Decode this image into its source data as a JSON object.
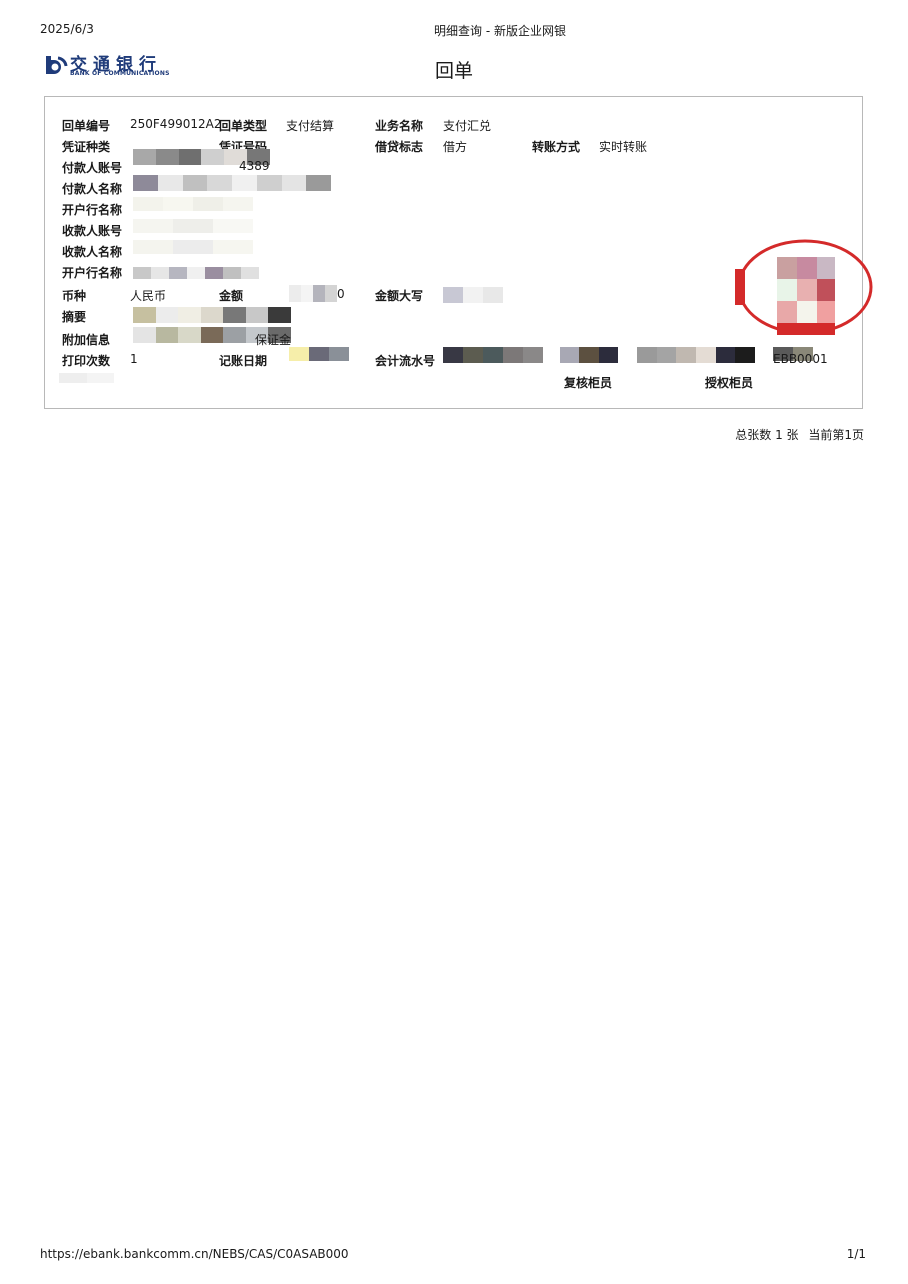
{
  "header": {
    "date": "2025/6/3",
    "page_title": "明细查询 - 新版企业网银"
  },
  "logo": {
    "cn_text": "交通银行",
    "en_text": "BANK OF COMMUNICATIONS",
    "mark_icon": "bocom-logo-icon"
  },
  "doc_title": "回单",
  "receipt": {
    "receipt_no_label": "回单编号",
    "receipt_no": "250F499012A2",
    "receipt_type_label": "回单类型",
    "receipt_type": "支付结算",
    "business_name_label": "业务名称",
    "business_name": "支付汇兑",
    "voucher_type_label": "凭证种类",
    "voucher_no_label": "凭证号码",
    "debit_credit_label": "借贷标志",
    "debit_credit": "借方",
    "transfer_mode_label": "转账方式",
    "transfer_mode": "实时转账",
    "payer_account_label": "付款人账号",
    "payer_account_partial": "4389",
    "payer_name_label": "付款人名称",
    "payer_bank_label": "开户行名称",
    "payee_account_label": "收款人账号",
    "payee_name_label": "收款人名称",
    "payee_bank_label": "开户行名称",
    "currency_label": "币种",
    "currency": "人民币",
    "amount_label": "金额",
    "amount_partial": "0",
    "amount_upper_label": "金额大写",
    "summary_label": "摘要",
    "extra_info_label": "附加信息",
    "extra_info_partial": "保证金",
    "print_count_label": "打印次数",
    "print_count": "1",
    "post_date_label": "记账日期",
    "serial_label": "会计流水号",
    "teller_partial": "EBB0001",
    "review_teller_label": "复核柜员",
    "auth_teller_label": "授权柜员",
    "redaction_color": "#9a9a9a",
    "stamp_color": "#d42a2a"
  },
  "pageinfo": {
    "total": "总张数 1 张",
    "current": "当前第1页"
  },
  "footer": {
    "url": "https://ebank.bankcomm.cn/NEBS/CAS/C0ASAB000",
    "page": "1/1"
  }
}
